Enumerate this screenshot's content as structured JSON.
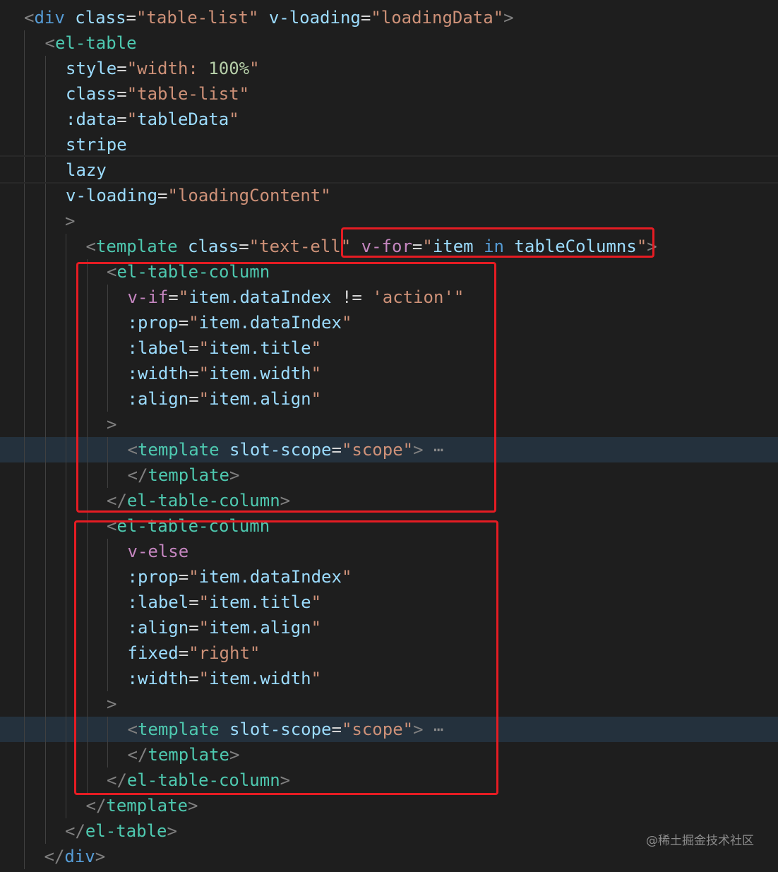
{
  "watermark": "@稀土掘金技术社区",
  "lines": [
    {
      "indent": 0,
      "tokens": [
        {
          "t": "<",
          "c": "punct"
        },
        {
          "t": "div",
          "c": "tag"
        },
        {
          "t": " ",
          "c": "plain"
        },
        {
          "t": "class",
          "c": "attr"
        },
        {
          "t": "=",
          "c": "plain"
        },
        {
          "t": "\"table-list\"",
          "c": "str"
        },
        {
          "t": " ",
          "c": "plain"
        },
        {
          "t": "v-loading",
          "c": "attr"
        },
        {
          "t": "=",
          "c": "plain"
        },
        {
          "t": "\"loadingData\"",
          "c": "str"
        },
        {
          "t": ">",
          "c": "punct"
        }
      ]
    },
    {
      "indent": 1,
      "tokens": [
        {
          "t": "<",
          "c": "punct"
        },
        {
          "t": "el-table",
          "c": "tag2"
        }
      ]
    },
    {
      "indent": 2,
      "tokens": [
        {
          "t": "style",
          "c": "attr"
        },
        {
          "t": "=",
          "c": "plain"
        },
        {
          "t": "\"width: ",
          "c": "str"
        },
        {
          "t": "100%",
          "c": "num"
        },
        {
          "t": "\"",
          "c": "str"
        }
      ]
    },
    {
      "indent": 2,
      "tokens": [
        {
          "t": "class",
          "c": "attr"
        },
        {
          "t": "=",
          "c": "plain"
        },
        {
          "t": "\"table-list\"",
          "c": "str"
        }
      ]
    },
    {
      "indent": 2,
      "tokens": [
        {
          "t": ":data",
          "c": "attr"
        },
        {
          "t": "=",
          "c": "plain"
        },
        {
          "t": "\"",
          "c": "str"
        },
        {
          "t": "tableData",
          "c": "id"
        },
        {
          "t": "\"",
          "c": "str"
        }
      ]
    },
    {
      "indent": 2,
      "tokens": [
        {
          "t": "stripe",
          "c": "attr"
        }
      ]
    },
    {
      "indent": 2,
      "tokens": [
        {
          "t": "lazy",
          "c": "attr"
        }
      ]
    },
    {
      "indent": 2,
      "tokens": [
        {
          "t": "v-loading",
          "c": "attr"
        },
        {
          "t": "=",
          "c": "plain"
        },
        {
          "t": "\"loadingContent\"",
          "c": "str"
        }
      ]
    },
    {
      "indent": 2,
      "shift": -1,
      "tokens": [
        {
          "t": ">",
          "c": "punct"
        }
      ]
    },
    {
      "indent": 3,
      "shift": -1,
      "tokens": [
        {
          "t": "<",
          "c": "punct"
        },
        {
          "t": "template",
          "c": "tag2"
        },
        {
          "t": " ",
          "c": "plain"
        },
        {
          "t": "class",
          "c": "attr"
        },
        {
          "t": "=",
          "c": "plain"
        },
        {
          "t": "\"text-ell\"",
          "c": "str"
        },
        {
          "t": " ",
          "c": "plain"
        },
        {
          "t": "v-for",
          "c": "kw"
        },
        {
          "t": "=",
          "c": "plain"
        },
        {
          "t": "\"",
          "c": "str"
        },
        {
          "t": "item",
          "c": "id"
        },
        {
          "t": " ",
          "c": "plain"
        },
        {
          "t": "in",
          "c": "tag"
        },
        {
          "t": " ",
          "c": "plain"
        },
        {
          "t": "tableColumns",
          "c": "id"
        },
        {
          "t": "\"",
          "c": "str"
        },
        {
          "t": ">",
          "c": "punct"
        }
      ]
    },
    {
      "indent": 4,
      "shift": -1,
      "tokens": [
        {
          "t": "<",
          "c": "punct"
        },
        {
          "t": "el-table-column",
          "c": "tag2"
        }
      ]
    },
    {
      "indent": 5,
      "shift": -1,
      "tokens": [
        {
          "t": "v-if",
          "c": "kw"
        },
        {
          "t": "=",
          "c": "plain"
        },
        {
          "t": "\"",
          "c": "str"
        },
        {
          "t": "item.dataIndex",
          "c": "id"
        },
        {
          "t": " != ",
          "c": "plain"
        },
        {
          "t": "'action'",
          "c": "str"
        },
        {
          "t": "\"",
          "c": "str"
        }
      ]
    },
    {
      "indent": 5,
      "shift": -1,
      "tokens": [
        {
          "t": ":prop",
          "c": "attr"
        },
        {
          "t": "=",
          "c": "plain"
        },
        {
          "t": "\"",
          "c": "str"
        },
        {
          "t": "item.dataIndex",
          "c": "id"
        },
        {
          "t": "\"",
          "c": "str"
        }
      ]
    },
    {
      "indent": 5,
      "shift": -1,
      "tokens": [
        {
          "t": ":label",
          "c": "attr"
        },
        {
          "t": "=",
          "c": "plain"
        },
        {
          "t": "\"",
          "c": "str"
        },
        {
          "t": "item.title",
          "c": "id"
        },
        {
          "t": "\"",
          "c": "str"
        }
      ]
    },
    {
      "indent": 5,
      "shift": -1,
      "tokens": [
        {
          "t": ":width",
          "c": "attr"
        },
        {
          "t": "=",
          "c": "plain"
        },
        {
          "t": "\"",
          "c": "str"
        },
        {
          "t": "item.width",
          "c": "id"
        },
        {
          "t": "\"",
          "c": "str"
        }
      ]
    },
    {
      "indent": 5,
      "shift": -1,
      "tokens": [
        {
          "t": ":align",
          "c": "attr"
        },
        {
          "t": "=",
          "c": "plain"
        },
        {
          "t": "\"",
          "c": "str"
        },
        {
          "t": "item.align",
          "c": "id"
        },
        {
          "t": "\"",
          "c": "str"
        }
      ]
    },
    {
      "indent": 4,
      "shift": -1,
      "tokens": [
        {
          "t": ">",
          "c": "punct"
        }
      ]
    },
    {
      "indent": 5,
      "shift": -1,
      "highlight": true,
      "tokens": [
        {
          "t": "<",
          "c": "punct"
        },
        {
          "t": "template",
          "c": "tag2"
        },
        {
          "t": " ",
          "c": "plain"
        },
        {
          "t": "slot-scope",
          "c": "attr"
        },
        {
          "t": "=",
          "c": "plain"
        },
        {
          "t": "\"scope\"",
          "c": "str"
        },
        {
          "t": ">",
          "c": "punct"
        },
        {
          "t": " ⋯",
          "c": "ellipsis"
        }
      ]
    },
    {
      "indent": 5,
      "shift": -1,
      "tokens": [
        {
          "t": "</",
          "c": "punct"
        },
        {
          "t": "template",
          "c": "tag2"
        },
        {
          "t": ">",
          "c": "punct"
        }
      ]
    },
    {
      "indent": 4,
      "shift": -1,
      "tokens": [
        {
          "t": "</",
          "c": "punct"
        },
        {
          "t": "el-table-column",
          "c": "tag2"
        },
        {
          "t": ">",
          "c": "punct"
        }
      ]
    },
    {
      "indent": 4,
      "shift": -1,
      "tokens": [
        {
          "t": "<",
          "c": "punct"
        },
        {
          "t": "el-table-column",
          "c": "tag2"
        }
      ]
    },
    {
      "indent": 5,
      "shift": -1,
      "tokens": [
        {
          "t": "v-else",
          "c": "kw"
        }
      ]
    },
    {
      "indent": 5,
      "shift": -1,
      "tokens": [
        {
          "t": ":prop",
          "c": "attr"
        },
        {
          "t": "=",
          "c": "plain"
        },
        {
          "t": "\"",
          "c": "str"
        },
        {
          "t": "item.dataIndex",
          "c": "id"
        },
        {
          "t": "\"",
          "c": "str"
        }
      ]
    },
    {
      "indent": 5,
      "shift": -1,
      "tokens": [
        {
          "t": ":label",
          "c": "attr"
        },
        {
          "t": "=",
          "c": "plain"
        },
        {
          "t": "\"",
          "c": "str"
        },
        {
          "t": "item.title",
          "c": "id"
        },
        {
          "t": "\"",
          "c": "str"
        }
      ]
    },
    {
      "indent": 5,
      "shift": -1,
      "tokens": [
        {
          "t": ":align",
          "c": "attr"
        },
        {
          "t": "=",
          "c": "plain"
        },
        {
          "t": "\"",
          "c": "str"
        },
        {
          "t": "item.align",
          "c": "id"
        },
        {
          "t": "\"",
          "c": "str"
        }
      ]
    },
    {
      "indent": 5,
      "shift": -1,
      "tokens": [
        {
          "t": "fixed",
          "c": "attr"
        },
        {
          "t": "=",
          "c": "plain"
        },
        {
          "t": "\"right\"",
          "c": "str"
        }
      ]
    },
    {
      "indent": 5,
      "shift": -1,
      "tokens": [
        {
          "t": ":width",
          "c": "attr"
        },
        {
          "t": "=",
          "c": "plain"
        },
        {
          "t": "\"",
          "c": "str"
        },
        {
          "t": "item.width",
          "c": "id"
        },
        {
          "t": "\"",
          "c": "str"
        }
      ]
    },
    {
      "indent": 4,
      "shift": -1,
      "tokens": [
        {
          "t": ">",
          "c": "punct"
        }
      ]
    },
    {
      "indent": 5,
      "shift": -1,
      "highlight": true,
      "tokens": [
        {
          "t": "<",
          "c": "punct"
        },
        {
          "t": "template",
          "c": "tag2"
        },
        {
          "t": " ",
          "c": "plain"
        },
        {
          "t": "slot-scope",
          "c": "attr"
        },
        {
          "t": "=",
          "c": "plain"
        },
        {
          "t": "\"scope\"",
          "c": "str"
        },
        {
          "t": ">",
          "c": "punct"
        },
        {
          "t": " ⋯",
          "c": "ellipsis"
        }
      ]
    },
    {
      "indent": 5,
      "shift": -1,
      "tokens": [
        {
          "t": "</",
          "c": "punct"
        },
        {
          "t": "template",
          "c": "tag2"
        },
        {
          "t": ">",
          "c": "punct"
        }
      ]
    },
    {
      "indent": 4,
      "shift": -1,
      "tokens": [
        {
          "t": "</",
          "c": "punct"
        },
        {
          "t": "el-table-column",
          "c": "tag2"
        },
        {
          "t": ">",
          "c": "punct"
        }
      ]
    },
    {
      "indent": 3,
      "shift": -1,
      "tokens": [
        {
          "t": "</",
          "c": "punct"
        },
        {
          "t": "template",
          "c": "tag2"
        },
        {
          "t": ">",
          "c": "punct"
        }
      ]
    },
    {
      "indent": 2,
      "shift": -1,
      "tokens": [
        {
          "t": "</",
          "c": "punct"
        },
        {
          "t": "el-table",
          "c": "tag2"
        },
        {
          "t": ">",
          "c": "punct"
        }
      ]
    },
    {
      "indent": 1,
      "shift": -1,
      "tokens": [
        {
          "t": "</",
          "c": "punct"
        },
        {
          "t": "div",
          "c": "tag"
        },
        {
          "t": ">",
          "c": "punct"
        }
      ]
    }
  ]
}
